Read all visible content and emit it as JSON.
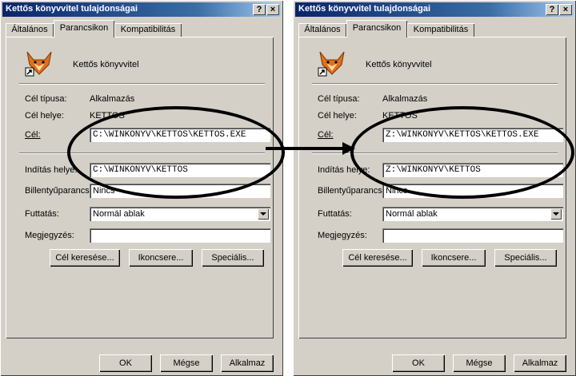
{
  "windows": [
    {
      "title": "Kettős könyvvitel tulajdonságai",
      "tabs": [
        "Általános",
        "Parancsikon",
        "Kompatibilitás"
      ],
      "app_name": "Kettős könyvvitel",
      "fields": {
        "target_type_label": "Cél típusa:",
        "target_type_value": "Alkalmazás",
        "target_location_label": "Cél helye:",
        "target_location_value": "KETTOS",
        "target_label": "Cél:",
        "target_value": "C:\\WINKONYV\\KETTOS\\KETTOS.EXE",
        "start_in_label": "Indítás helye:",
        "start_in_value": "C:\\WINKONYV\\KETTOS",
        "shortcut_key_label": "Billentyűparancs:",
        "shortcut_key_value": "Nincs",
        "run_label": "Futtatás:",
        "run_value": "Normál ablak",
        "comment_label": "Megjegyzés:",
        "comment_value": ""
      },
      "buttons": {
        "find_target": "Cél keresése...",
        "change_icon": "Ikoncsere...",
        "advanced": "Speciális..."
      },
      "footer": {
        "ok": "OK",
        "cancel": "Mégse",
        "apply": "Alkalmaz"
      },
      "titlebar_buttons": {
        "help": "?",
        "close": "×"
      }
    },
    {
      "title": "Kettős könyvvitel tulajdonságai",
      "tabs": [
        "Általános",
        "Parancsikon",
        "Kompatibilitás"
      ],
      "app_name": "Kettős könyvvitel",
      "fields": {
        "target_type_label": "Cél típusa:",
        "target_type_value": "Alkalmazás",
        "target_location_label": "Cél helye:",
        "target_location_value": "KETTOS",
        "target_label": "Cél:",
        "target_value": "Z:\\WINKONYV\\KETTOS\\KETTOS.EXE",
        "start_in_label": "Indítás helye:",
        "start_in_value": "Z:\\WINKONYV\\KETTOS",
        "shortcut_key_label": "Billentyűparancs:",
        "shortcut_key_value": "Nincs",
        "run_label": "Futtatás:",
        "run_value": "Normál ablak",
        "comment_label": "Megjegyzés:",
        "comment_value": ""
      },
      "buttons": {
        "find_target": "Cél keresése...",
        "change_icon": "Ikoncsere...",
        "advanced": "Speciális..."
      },
      "footer": {
        "ok": "OK",
        "cancel": "Mégse",
        "apply": "Alkalmaz"
      },
      "titlebar_buttons": {
        "help": "?",
        "close": "×"
      }
    }
  ],
  "colors": {
    "titlebar_start": "#0a246a",
    "titlebar_end": "#a6caf0",
    "face": "#d4d0c8"
  }
}
